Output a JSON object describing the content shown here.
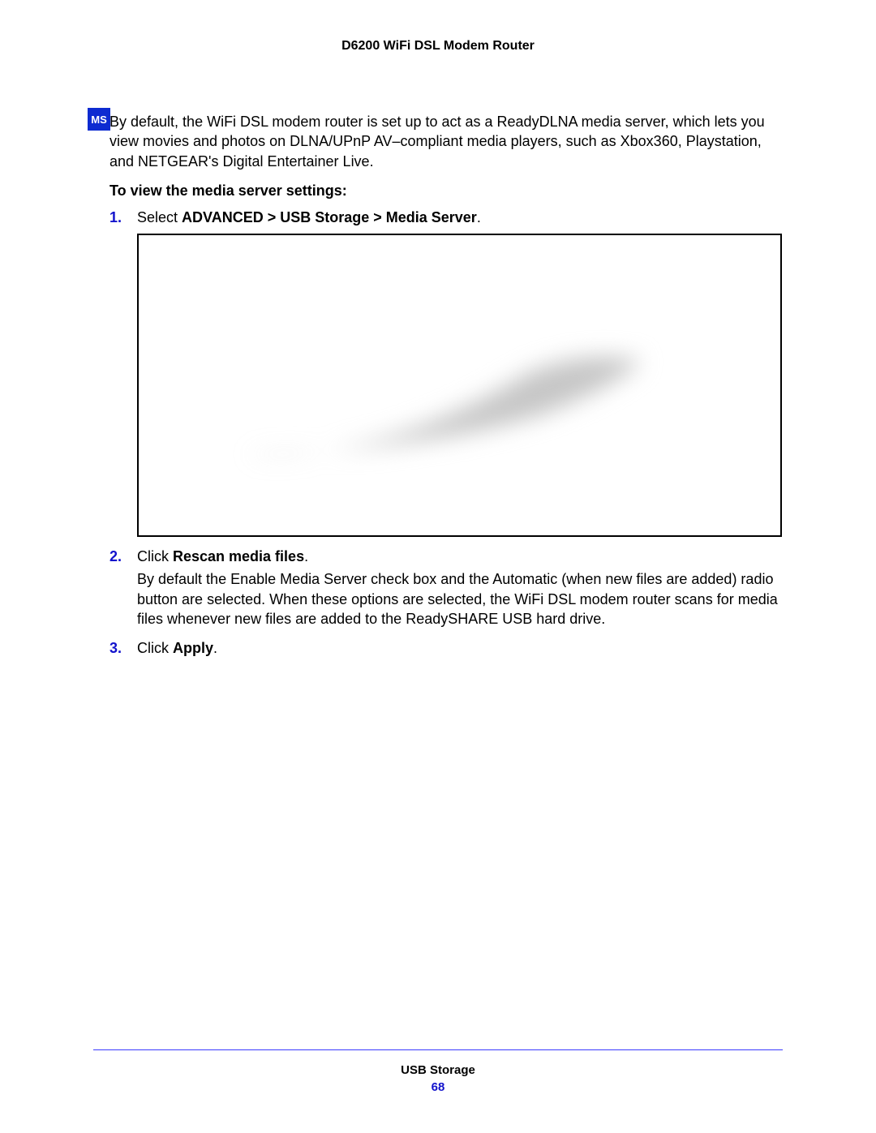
{
  "header": {
    "title": "D6200 WiFi DSL Modem Router"
  },
  "section_icon_label": "MS",
  "intro": "By default, the WiFi DSL modem router is set up to act as a ReadyDLNA media server, which lets you view movies and photos on DLNA/UPnP AV–compliant media players, such as Xbox360, Playstation, and NETGEAR's Digital Entertainer Live.",
  "subhead": "To view the media server settings:",
  "steps": [
    {
      "num": "1.",
      "prefix": "Select ",
      "bold": "ADVANCED > USB Storage > Media Server",
      "suffix": ".",
      "has_image": true
    },
    {
      "num": "2.",
      "prefix": "Click ",
      "bold": "Rescan media files",
      "suffix": ".",
      "body": "By default the Enable Media Server check box and the Automatic (when new files are added) radio button are selected. When these options are selected, the WiFi DSL modem router scans for media files whenever new files are added to the ReadySHARE USB hard drive."
    },
    {
      "num": "3.",
      "prefix": "Click ",
      "bold": "Apply",
      "suffix": "."
    }
  ],
  "footer": {
    "section": "USB Storage",
    "page": "68"
  }
}
